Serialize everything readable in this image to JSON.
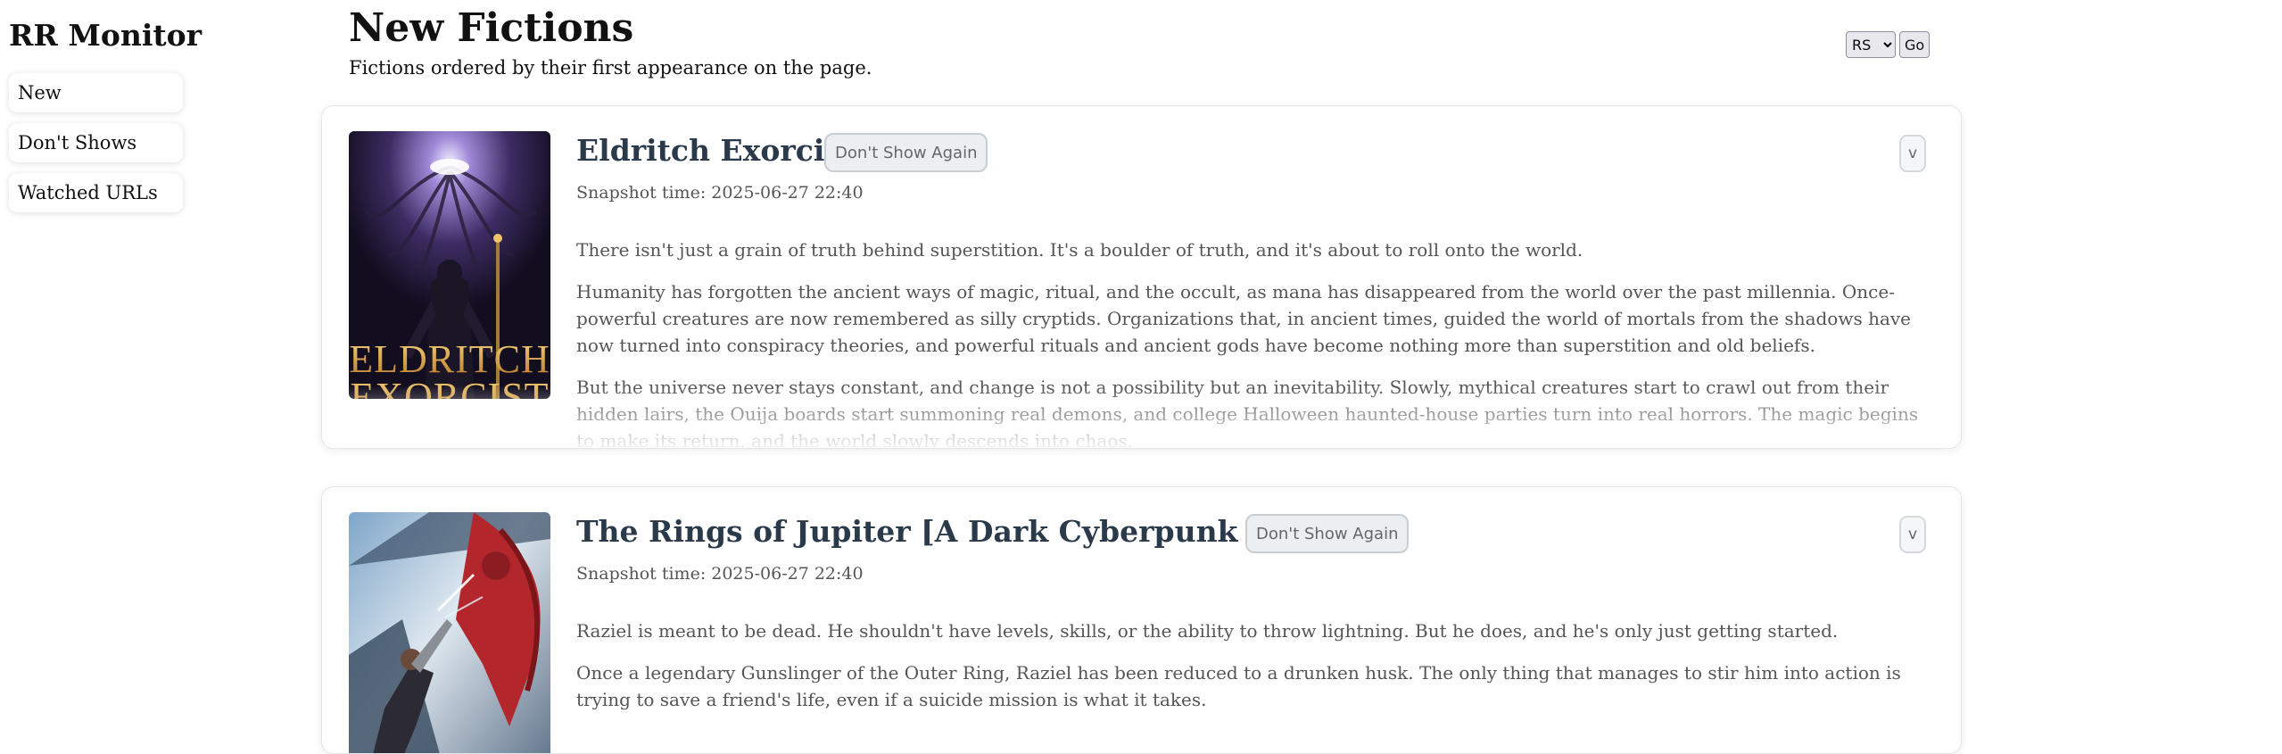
{
  "sidebar": {
    "brand": "RR Monitor",
    "items": [
      {
        "label": "New"
      },
      {
        "label": "Don't Shows"
      },
      {
        "label": "Watched URLs"
      }
    ]
  },
  "header": {
    "title": "New Fictions",
    "subtitle": "Fictions ordered by their first appearance on the page.",
    "select_value": "RS",
    "go_label": "Go"
  },
  "fictions": [
    {
      "title": "Eldritch Exorcist",
      "cover_text_1": "ELDRITCH",
      "cover_text_2": "EXORCIST",
      "dont_show_label": "Don't Show Again",
      "expand_label": "v",
      "snapshot": "Snapshot time: 2025-06-27 22:40",
      "paragraphs": [
        "There isn't just a grain of truth behind superstition. It's a boulder of truth, and it's about to roll onto the world.",
        "Humanity has forgotten the ancient ways of magic, ritual, and the occult, as mana has disappeared from the world over the past millennia. Once-powerful creatures are now remembered as silly cryptids. Organizations that, in ancient times, guided the world of mortals from the shadows have now turned into conspiracy theories, and powerful rituals and ancient gods have become nothing more than superstition and old beliefs.",
        "But the universe never stays constant, and change is not a possibility but an inevitability. Slowly, mythical creatures start to crawl out from their hidden lairs, the Ouija boards start summoning real demons, and college Halloween haunted-house parties turn into real horrors. The magic begins to make its return, and the world slowly descends into chaos."
      ]
    },
    {
      "title": "The Rings of Jupiter [A Dark Cyberpunk LitRPG]",
      "dont_show_label": "Don't Show Again",
      "expand_label": "v",
      "snapshot": "Snapshot time: 2025-06-27 22:40",
      "paragraphs": [
        "Raziel is meant to be dead. He shouldn't have levels, skills, or the ability to throw lightning. But he does, and he's only just getting started.",
        "Once a legendary Gunslinger of the Outer Ring, Raziel has been reduced to a drunken husk. The only thing that manages to stir him into action is trying to save a friend's life, even if a suicide mission is what it takes."
      ]
    }
  ],
  "colors": {
    "title_text": "#2b3a4a",
    "cover1_gold": "#d9a441",
    "cover2_red": "#b3262c"
  }
}
